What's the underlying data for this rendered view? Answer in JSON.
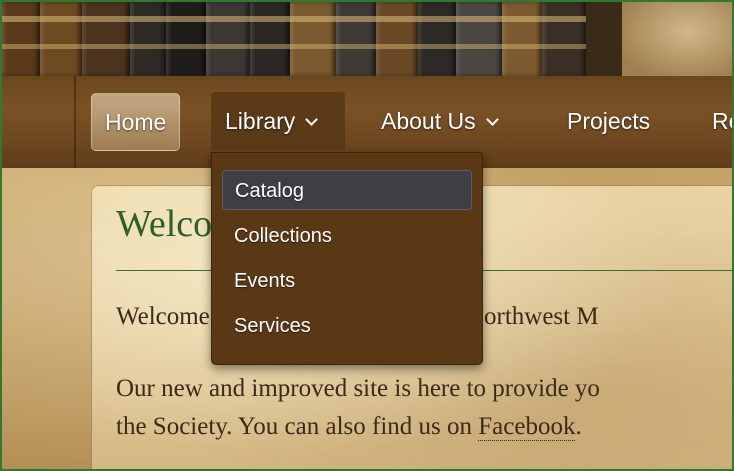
{
  "header": {
    "image": "bookshelf-banner"
  },
  "nav": {
    "home": "Home",
    "library": "Library",
    "about": "About Us",
    "projects": "Projects",
    "truncated": "Re"
  },
  "library_menu": {
    "items": [
      "Catalog",
      "Collections",
      "Events",
      "Services"
    ],
    "highlighted": "Catalog"
  },
  "content": {
    "title": "Welcome!",
    "paragraph1": "Welcome to the home page for the Northwest M",
    "paragraph2_line1": "Our new and improved site is here to provide yo",
    "paragraph2_line2_prefix": "the Society. You can also find us on ",
    "facebook_link": "Facebook",
    "paragraph2_line2_suffix": "."
  },
  "colors": {
    "nav_bg": "#6b461e",
    "dropdown_bg": "#5a3715",
    "highlight_bg": "#3d3f45",
    "title_green": "#2e5e2e"
  }
}
